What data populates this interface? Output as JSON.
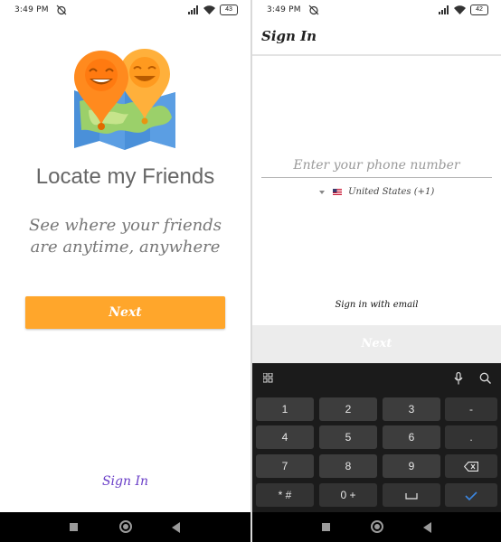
{
  "left_screen": {
    "status_bar": {
      "time": "3:49 PM",
      "battery": "43"
    },
    "app_title": "Locate my Friends",
    "tagline": "See where your friends are anytime, anywhere",
    "next_button": "Next",
    "sign_in_link": "Sign In"
  },
  "right_screen": {
    "status_bar": {
      "time": "3:49 PM",
      "battery": "42"
    },
    "toolbar_title": "Sign In",
    "phone_input": {
      "placeholder": "Enter your phone number",
      "value": ""
    },
    "country": "United States (+1)",
    "email_link": "Sign in with email",
    "next_button": "Next",
    "keyboard": {
      "rows": [
        [
          "1",
          "2",
          "3",
          "-"
        ],
        [
          "4",
          "5",
          "6",
          "."
        ],
        [
          "7",
          "8",
          "9",
          "backspace"
        ],
        [
          "*#",
          "0 +",
          "space",
          "enter"
        ]
      ],
      "labels": {
        "k1": "1",
        "k2": "2",
        "k3": "3",
        "dash": "-",
        "k4": "4",
        "k5": "5",
        "k6": "6",
        "dot": ".",
        "k7": "7",
        "k8": "8",
        "k9": "9",
        "star_hash": "* #",
        "zero_plus": "0 +"
      }
    }
  },
  "colors": {
    "accent_orange": "#FFA62B",
    "link_purple": "#6A3FC8",
    "keyboard_bg": "#1b1b1b",
    "key_bg": "#3d3d3d",
    "enter_blue": "#3b86e0"
  },
  "icons": [
    "alarm-icon",
    "signal-icon",
    "wifi-icon",
    "battery-icon",
    "map-pin-logo",
    "apps-grid-icon",
    "mic-icon",
    "search-icon",
    "backspace-icon",
    "space-icon",
    "check-icon",
    "nav-recents-icon",
    "nav-home-icon",
    "nav-back-icon",
    "us-flag-icon",
    "dropdown-caret-icon"
  ]
}
